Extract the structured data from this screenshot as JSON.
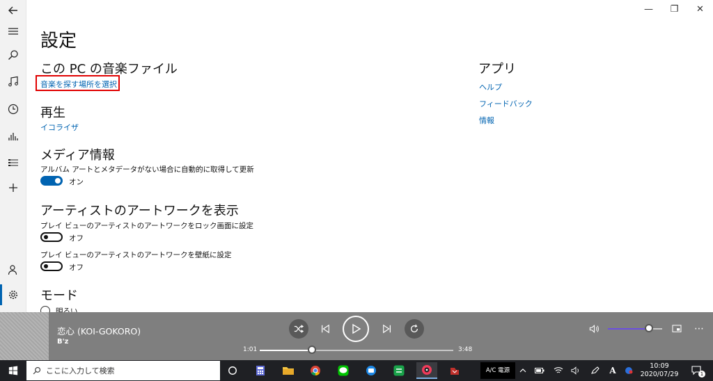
{
  "app": {
    "page_title": "設定",
    "window_controls": {
      "minimize": "—",
      "maximize": "❐",
      "close": "✕"
    }
  },
  "nav": {
    "icons": [
      "back-arrow-icon",
      "hamburger-menu-icon",
      "search-icon",
      "music-note-icon",
      "recent-clock-icon",
      "now-playing-bars-icon",
      "playlist-icon",
      "add-icon",
      "account-icon",
      "settings-gear-icon"
    ]
  },
  "sections": {
    "music_files": {
      "heading": "この PC の音楽ファイル",
      "link": "音楽を探す場所を選択"
    },
    "playback": {
      "heading": "再生",
      "link": "イコライザ"
    },
    "media_info": {
      "heading": "メディア情報",
      "description": "アルバム アートとメタデータがない場合に自動的に取得して更新",
      "toggle_label": "オン",
      "toggle_on": true
    },
    "artist_art": {
      "heading": "アーティストのアートワークを表示",
      "lock_desc": "プレイ ビューのアーティストのアートワークをロック画面に設定",
      "lock_toggle_label": "オフ",
      "lock_toggle_on": false,
      "wall_desc": "プレイ ビューのアーティストのアートワークを壁紙に設定",
      "wall_toggle_label": "オフ",
      "wall_toggle_on": false
    },
    "mode": {
      "heading": "モード",
      "option_light": "明るい"
    },
    "app_section": {
      "heading": "アプリ",
      "links": [
        "ヘルプ",
        "フィードバック",
        "情報"
      ]
    }
  },
  "player": {
    "song_title": "恋心 (KOI-GOKORO)",
    "artist": "B'z",
    "elapsed": "1:01",
    "duration": "3:48",
    "progress": 0.27,
    "volume": 0.75
  },
  "taskbar": {
    "search_placeholder": "ここに入力して検索",
    "ime_label": "A",
    "ac_label": "A/C 電源",
    "time": "10:09",
    "date": "2020/07/29",
    "notification_count": "1"
  },
  "colors": {
    "accent": "#0063b1",
    "highlight_box": "#e00000",
    "player_bg": "#7f7f7f",
    "taskbar_bg": "#1f2024"
  }
}
